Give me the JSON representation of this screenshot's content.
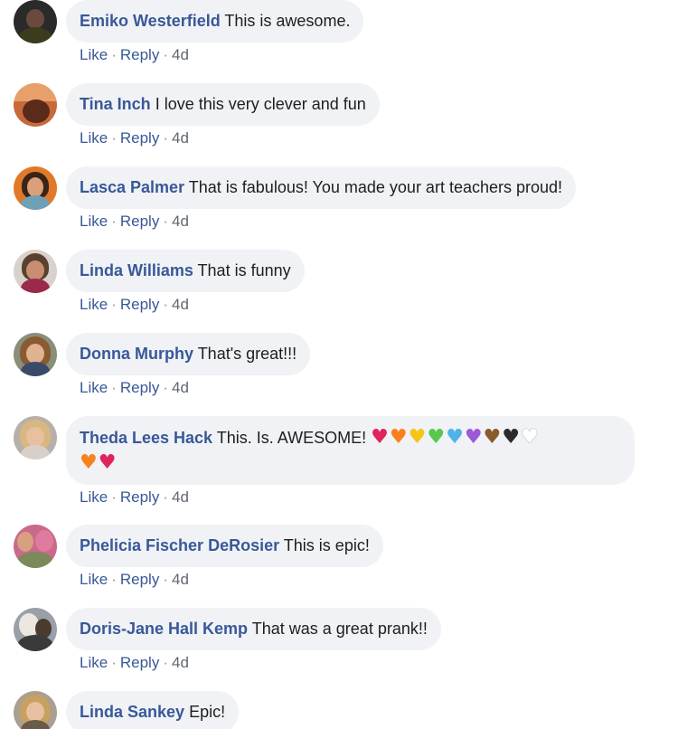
{
  "comments": [
    {
      "author": "Emiko Westerfield",
      "text": "This is awesome.",
      "like": "Like",
      "reply": "Reply",
      "time": "4d"
    },
    {
      "author": "Tina Inch",
      "text": "I love this very clever and fun",
      "like": "Like",
      "reply": "Reply",
      "time": "4d"
    },
    {
      "author": "Lasca Palmer",
      "text": "That is fabulous! You made your art teachers proud!",
      "like": "Like",
      "reply": "Reply",
      "time": "4d"
    },
    {
      "author": "Linda Williams",
      "text": "That is funny",
      "like": "Like",
      "reply": "Reply",
      "time": "4d"
    },
    {
      "author": "Donna Murphy",
      "text": "That's great!!!",
      "like": "Like",
      "reply": "Reply",
      "time": "4d"
    },
    {
      "author": "Theda Lees Hack",
      "text": "This. Is. AWESOME!",
      "like": "Like",
      "reply": "Reply",
      "time": "4d",
      "hearts_line1": [
        "#e0245e",
        "#f7821b",
        "#f5c518",
        "#57c84d",
        "#4fb3e8",
        "#9b59d6",
        "#8b5a2b",
        "#2b2b2b",
        "#ffffff"
      ],
      "hearts_line2": [
        "#f7821b",
        "#e0245e"
      ]
    },
    {
      "author": "Phelicia Fischer DeRosier",
      "text": "This is epic!",
      "like": "Like",
      "reply": "Reply",
      "time": "4d"
    },
    {
      "author": "Doris-Jane Hall Kemp",
      "text": "That was a great prank!!",
      "like": "Like",
      "reply": "Reply",
      "time": "4d"
    },
    {
      "author": "Linda Sankey",
      "text": "Epic!"
    }
  ],
  "separator": "·",
  "colors": {
    "author": "#385898",
    "bubble": "#f0f2f5",
    "meta": "#616770"
  }
}
